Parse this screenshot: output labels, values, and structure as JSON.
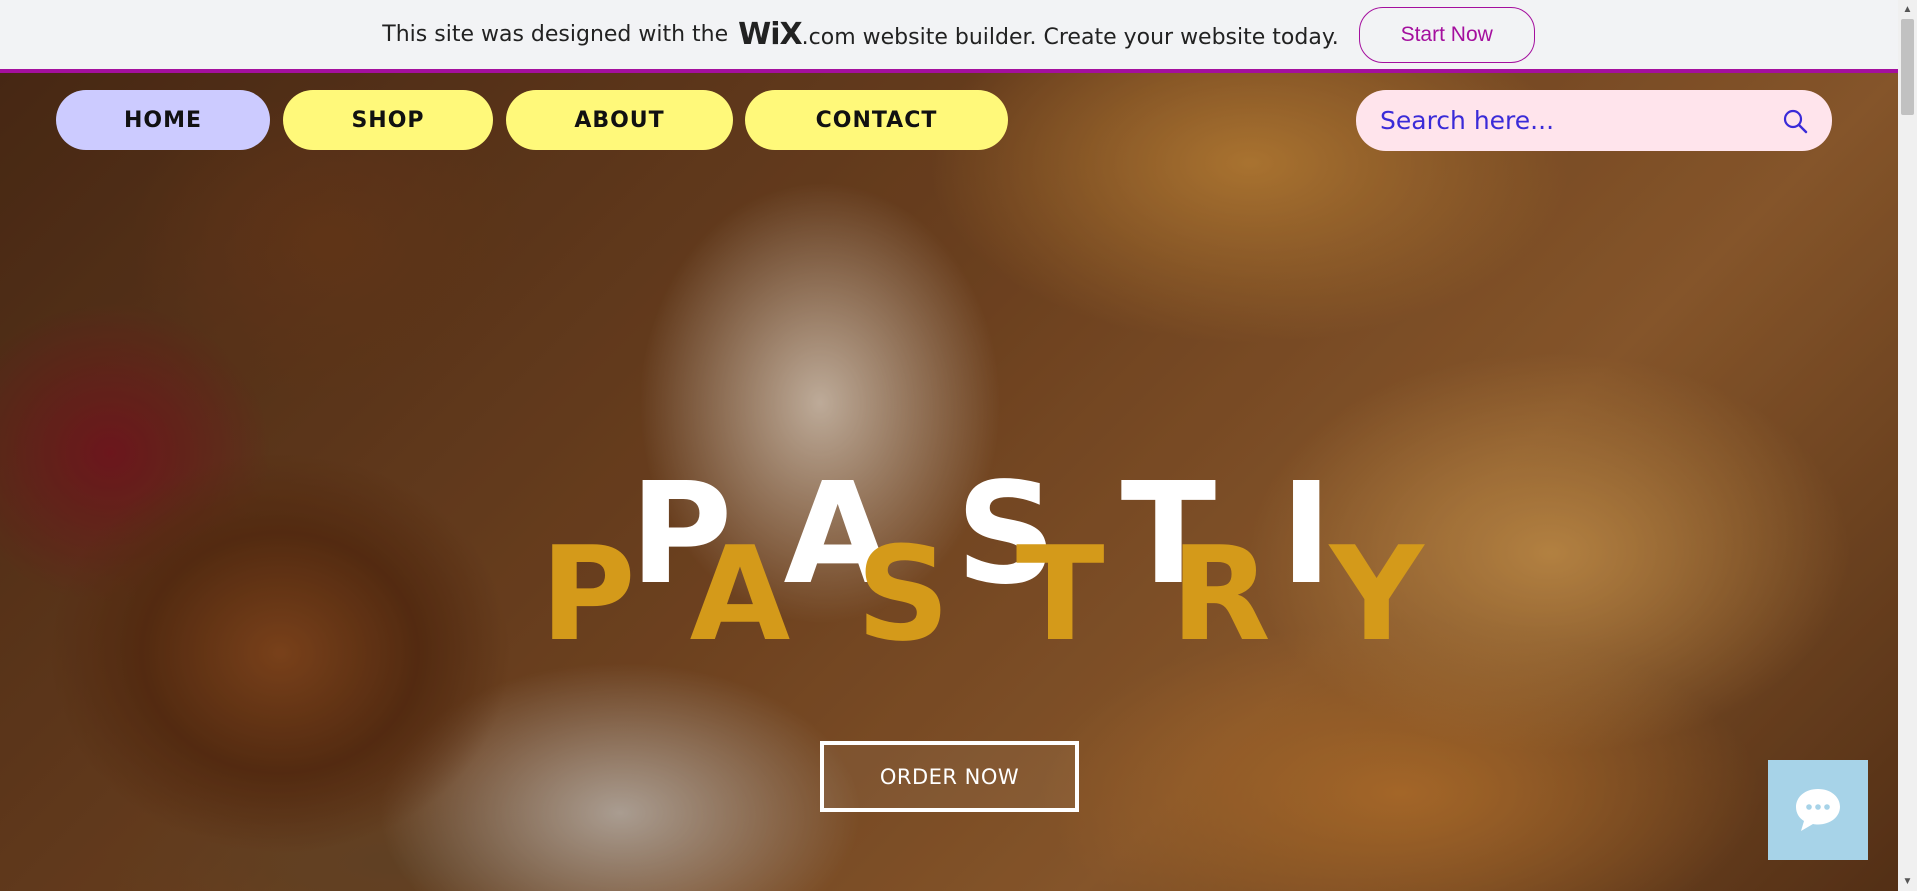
{
  "wix_banner": {
    "text_before": "This site was designed with the",
    "logo": "WiX",
    "text_after": ".com website builder. Create your website today.",
    "button": "Start Now",
    "accent_color": "#a40f9e"
  },
  "nav": {
    "items": [
      {
        "label": "HOME",
        "active": true
      },
      {
        "label": "SHOP"
      },
      {
        "label": "ABOUT"
      },
      {
        "label": "CONTACT"
      }
    ],
    "active_color": "#cccbff",
    "item_color": "#fff97a"
  },
  "search": {
    "placeholder": "Search here...",
    "icon": "search-icon",
    "bg_color": "#ffe4ec"
  },
  "hero": {
    "title_white": "PASTI",
    "title_gold": "PASTRY",
    "gold_color": "#d49a1a",
    "order_button": "ORDER NOW"
  },
  "chat": {
    "icon": "chat-bubble-icon",
    "bg_color": "#a7d3e8"
  }
}
